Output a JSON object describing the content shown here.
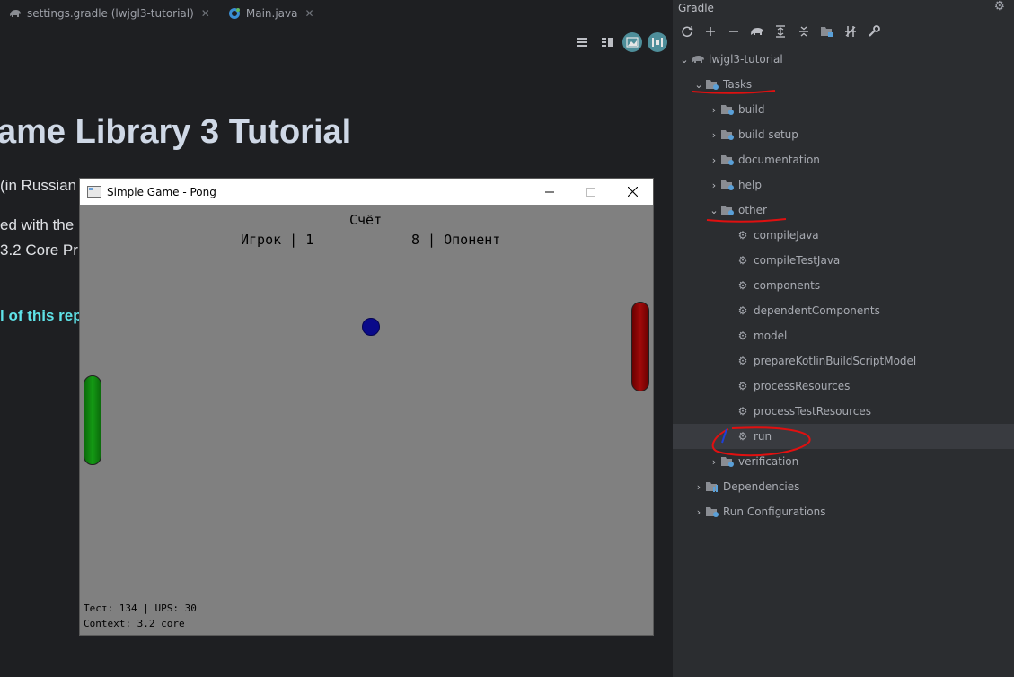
{
  "editor": {
    "tabs": [
      {
        "label": "settings.gradle (lwjgl3-tutorial)",
        "icon": "gradle-elephant-icon"
      },
      {
        "label": "Main.java",
        "icon": "java-class-icon"
      }
    ],
    "toolbar": [
      "editor-only-icon",
      "split-editor-icon",
      "preview-only-icon",
      "markdown-preview-icon"
    ],
    "markdown": {
      "heading": "ame Library 3 Tutorial",
      "line1": "(in Russian",
      "line2": "ed with the",
      "line3": "3.2 Core Pr",
      "link": "l of this repo"
    }
  },
  "game": {
    "title": "Simple Game - Pong",
    "score_title": "Счёт",
    "score_player": "Игрок | 1",
    "score_opponent": "8 | Опонент",
    "debug_line1": "Тест: 134 | UPS: 30",
    "debug_line2": "Context: 3.2 core",
    "colors": {
      "left_paddle": "#149a14",
      "right_paddle": "#a00a0a",
      "ball": "#0a0a8a",
      "background": "#808080"
    }
  },
  "gradle": {
    "title": "Gradle",
    "toolbar_icons": [
      "refresh-icon",
      "add-icon",
      "remove-icon",
      "elephant-run-icon",
      "expand-all-icon",
      "collapse-all-icon",
      "group-tasks-icon",
      "toggle-offline-icon",
      "settings-wrench-icon"
    ],
    "tree": {
      "project": "lwjgl3-tutorial",
      "tasks": "Tasks",
      "groups": {
        "build": "build",
        "build_setup": "build setup",
        "documentation": "documentation",
        "help": "help",
        "other": "other"
      },
      "other_tasks": [
        "compileJava",
        "compileTestJava",
        "components",
        "dependentComponents",
        "model",
        "prepareKotlinBuildScriptModel",
        "processResources",
        "processTestResources",
        "run"
      ],
      "verification": "verification",
      "dependencies": "Dependencies",
      "run_configurations": "Run Configurations"
    }
  }
}
